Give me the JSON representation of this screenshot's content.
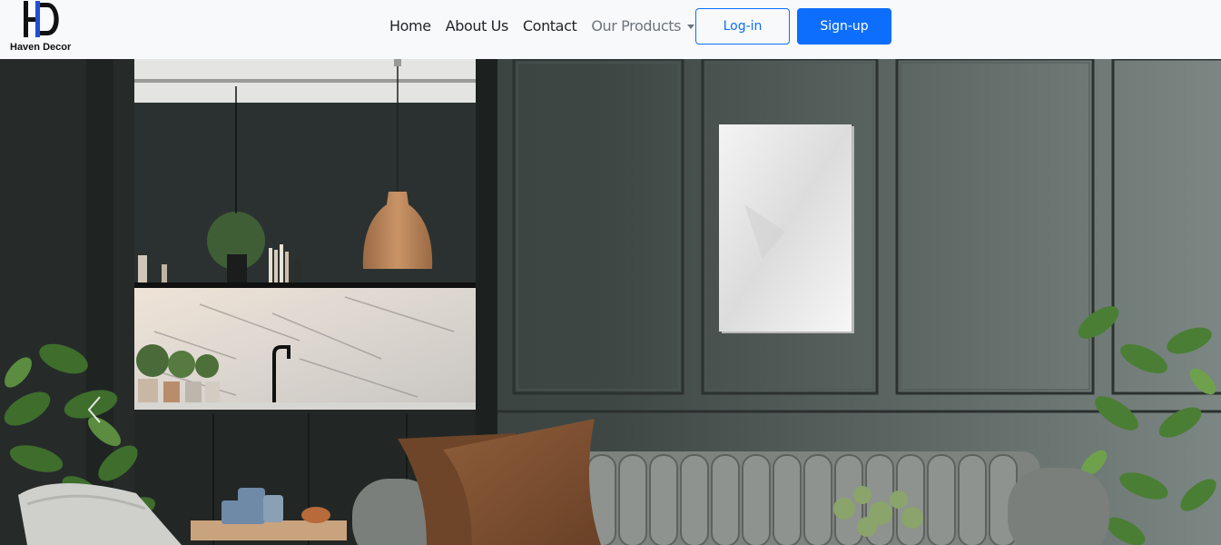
{
  "brand": {
    "logo_letters": "HD",
    "name": "Haven Decor"
  },
  "nav": {
    "links": [
      {
        "label": "Home"
      },
      {
        "label": "About Us"
      },
      {
        "label": "Contact"
      },
      {
        "label": "Our Products"
      }
    ]
  },
  "auth": {
    "login_label": "Log-in",
    "signup_label": "Sign-up"
  },
  "colors": {
    "primary": "#0d6efd",
    "navbar_bg": "#f8f9fa",
    "wall": "#3a4240"
  },
  "hero": {
    "prev_icon": "chevron-left-icon",
    "next_icon": "chevron-right-icon"
  }
}
